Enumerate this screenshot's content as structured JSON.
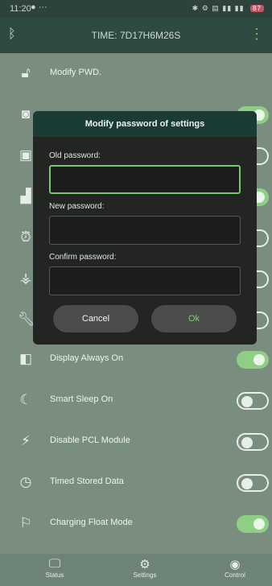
{
  "statusbar": {
    "time": "11:20",
    "battery": "87"
  },
  "appbar": {
    "title": "TIME: 7D17H6M26S"
  },
  "list": [
    {
      "label": "Modify PWD.",
      "icon": "unlock-icon",
      "toggle": null
    },
    {
      "label": "",
      "icon": "camera-icon",
      "toggle": "on"
    },
    {
      "label": "",
      "icon": "screen-icon",
      "toggle": "off"
    },
    {
      "label": "",
      "icon": "lock-icon",
      "toggle": "on"
    },
    {
      "label": "",
      "icon": "alarm-icon",
      "toggle": "off"
    },
    {
      "label": "",
      "icon": "lamp-icon",
      "toggle": "off"
    },
    {
      "label": "",
      "icon": "wrench-icon",
      "toggle": "off"
    },
    {
      "label": "Display Always On",
      "icon": "display-icon",
      "toggle": "on"
    },
    {
      "label": "Smart Sleep On",
      "icon": "moon-icon",
      "toggle": "off"
    },
    {
      "label": "Disable PCL Module",
      "icon": "plug-off-icon",
      "toggle": "off"
    },
    {
      "label": "Timed Stored Data",
      "icon": "clock-save-icon",
      "toggle": "off"
    },
    {
      "label": "Charging Float Mode",
      "icon": "flag-icon",
      "toggle": "on"
    }
  ],
  "dialog": {
    "title": "Modify password of settings",
    "old_label": "Old password:",
    "new_label": "New password:",
    "confirm_label": "Confirm password:",
    "old_value": "",
    "new_value": "",
    "confirm_value": "",
    "cancel_label": "Cancel",
    "ok_label": "Ok"
  },
  "nav": [
    {
      "label": "Status",
      "icon": "monitor-icon"
    },
    {
      "label": "Settings",
      "icon": "gear-icon"
    },
    {
      "label": "Control",
      "icon": "toggle-icon"
    }
  ],
  "colors": {
    "accent": "#8fcf85",
    "dialog_bg": "#222522",
    "header": "#1b3b35"
  }
}
